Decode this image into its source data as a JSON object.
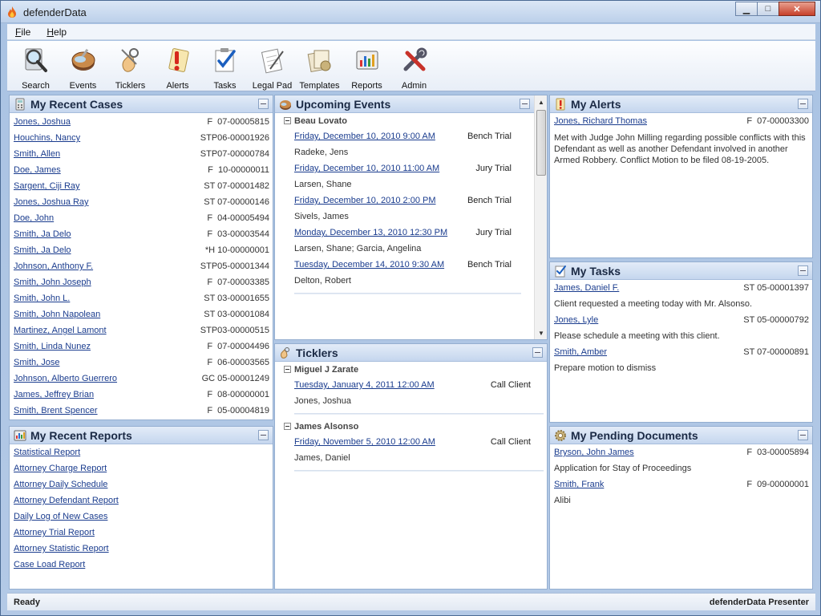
{
  "window": {
    "title": "defenderData"
  },
  "menu": [
    {
      "label": "File",
      "accel": "F"
    },
    {
      "label": "Help",
      "accel": "H"
    }
  ],
  "toolbar": [
    {
      "label": "Search",
      "icon": "search-icon"
    },
    {
      "label": "Events",
      "icon": "events-icon"
    },
    {
      "label": "Ticklers",
      "icon": "ticklers-icon"
    },
    {
      "label": "Alerts",
      "icon": "alerts-icon"
    },
    {
      "label": "Tasks",
      "icon": "tasks-icon"
    },
    {
      "label": "Legal Pad",
      "icon": "legal-pad-icon"
    },
    {
      "label": "Templates",
      "icon": "templates-icon"
    },
    {
      "label": "Reports",
      "icon": "reports-icon"
    },
    {
      "label": "Admin",
      "icon": "admin-icon"
    }
  ],
  "recent_cases": {
    "title": "My Recent Cases",
    "rows": [
      {
        "name": "Jones, Joshua",
        "number": "F  07-00005815"
      },
      {
        "name": "Houchins, Nancy",
        "number": "STP06-00001926"
      },
      {
        "name": "Smith, Allen",
        "number": "STP07-00000784"
      },
      {
        "name": "Doe, James",
        "number": "F  10-00000011"
      },
      {
        "name": "Sargent, Ciji Ray",
        "number": "ST 07-00001482"
      },
      {
        "name": "Jones, Joshua Ray",
        "number": "ST 07-00000146"
      },
      {
        "name": "Doe, John",
        "number": "F  04-00005494"
      },
      {
        "name": "Smith, Ja Delo",
        "number": "F  03-00003544"
      },
      {
        "name": "Smith, Ja Delo",
        "number": "*H 10-00000001"
      },
      {
        "name": "Johnson, Anthony F.",
        "number": "STP05-00001344"
      },
      {
        "name": "Smith, John Joseph",
        "number": "F  07-00003385"
      },
      {
        "name": "Smith, John L.",
        "number": "ST 03-00001655"
      },
      {
        "name": "Smith, John Napolean",
        "number": "ST 03-00001084"
      },
      {
        "name": "Martinez, Angel Lamont",
        "number": "STP03-00000515"
      },
      {
        "name": "Smith, Linda Nunez",
        "number": "F  07-00004496"
      },
      {
        "name": "Smith, Jose",
        "number": "F  06-00003565"
      },
      {
        "name": "Johnson, Alberto Guerrero",
        "number": "GC 05-00001249"
      },
      {
        "name": "James, Jeffrey Brian",
        "number": "F  08-00000001"
      },
      {
        "name": "Smith, Brent Spencer",
        "number": "F  05-00004819"
      }
    ]
  },
  "recent_reports": {
    "title": "My Recent Reports",
    "items": [
      "Statistical Report",
      "Attorney Charge Report",
      "Attorney Daily Schedule",
      "Attorney Defendant Report",
      "Daily Log of New Cases",
      "Attorney Trial Report",
      "Attorney Statistic Report",
      "Case Load Report"
    ]
  },
  "upcoming_events": {
    "title": "Upcoming Events",
    "group": "Beau  Lovato",
    "events": [
      {
        "date": "Friday, December 10, 2010 9:00 AM",
        "type": "Bench Trial",
        "who": "Radeke, Jens"
      },
      {
        "date": "Friday, December 10, 2010 11:00 AM",
        "type": "Jury Trial",
        "who": "Larsen, Shane"
      },
      {
        "date": "Friday, December 10, 2010 2:00 PM",
        "type": "Bench Trial",
        "who": "Sivels, James"
      },
      {
        "date": "Monday, December 13, 2010 12:30 PM",
        "type": "Jury Trial",
        "who": "Larsen, Shane; Garcia, Angelina"
      },
      {
        "date": "Tuesday, December 14, 2010 9:30 AM",
        "type": "Bench Trial",
        "who": "Delton, Robert"
      }
    ]
  },
  "ticklers": {
    "title": "Ticklers",
    "groups": [
      {
        "name": "Miguel J Zarate",
        "date": "Tuesday, January 4, 2011 12:00 AM",
        "type": "Call Client",
        "who": "Jones, Joshua"
      },
      {
        "name": "James  Alsonso",
        "date": "Friday, November 5, 2010 12:00 AM",
        "type": "Call Client",
        "who": "James, Daniel"
      }
    ]
  },
  "alerts": {
    "title": "My Alerts",
    "name": "Jones, Richard Thomas",
    "number": "F  07-00003300",
    "text": "Met with Judge John Milling regarding possible conflicts with this Defendant as well as another Defendant involved in another Armed Robbery.  Conflict Motion to be filed  08-19-2005."
  },
  "tasks": {
    "title": "My Tasks",
    "rows": [
      {
        "name": "James, Daniel F.",
        "number": "ST 05-00001397",
        "desc": "Client requested a meeting today with Mr. Alsonso."
      },
      {
        "name": "Jones, Lyle",
        "number": "ST 05-00000792",
        "desc": "Please schedule a meeting with this client."
      },
      {
        "name": "Smith, Amber",
        "number": "ST 07-00000891",
        "desc": "Prepare motion to dismiss"
      }
    ]
  },
  "pending_docs": {
    "title": "My Pending Documents",
    "rows": [
      {
        "name": "Bryson, John James",
        "number": "F  03-00005894",
        "desc": "Application for Stay of Proceedings"
      },
      {
        "name": "Smith, Frank",
        "number": "F  09-00000001",
        "desc": "Alibi"
      }
    ]
  },
  "status": {
    "left": "Ready",
    "right": "defenderData Presenter"
  }
}
